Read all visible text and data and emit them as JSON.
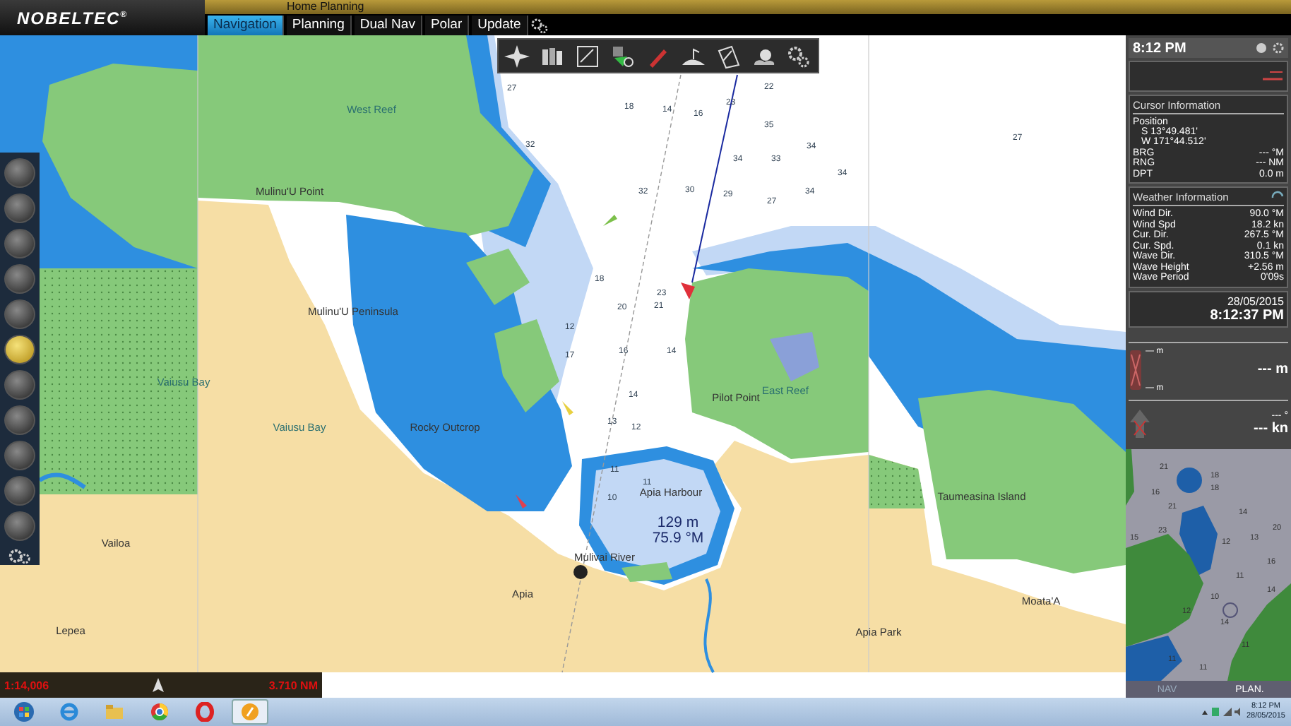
{
  "app": {
    "logo": "NOBELTEC$^{®}$",
    "title": "Home Planning"
  },
  "tabs": [
    {
      "label": "Navigation",
      "selected": true
    },
    {
      "label": "Planning",
      "selected": false
    },
    {
      "label": "Dual Nav",
      "selected": false
    },
    {
      "label": "Polar",
      "selected": false
    },
    {
      "label": "Update",
      "selected": false
    }
  ],
  "left_tools": [
    {
      "selected": false
    },
    {
      "selected": false
    },
    {
      "selected": false
    },
    {
      "selected": false
    },
    {
      "selected": false
    },
    {
      "selected": true
    },
    {
      "selected": false
    },
    {
      "selected": false
    },
    {
      "selected": false
    },
    {
      "selected": false
    },
    {
      "selected": false
    }
  ],
  "chart": {
    "labels": [
      {
        "text": "West Reef",
        "kind": "water"
      },
      {
        "text": "Mulinu'U Point",
        "kind": "place"
      },
      {
        "text": "Mulinu'U Peninsula",
        "kind": "place"
      },
      {
        "text": "Vaiusu Bay",
        "kind": "water"
      },
      {
        "text": "Vaiusu Bay",
        "kind": "water"
      },
      {
        "text": "Rocky Outcrop",
        "kind": "place"
      },
      {
        "text": "Pilot Point",
        "kind": "place"
      },
      {
        "text": "East Reef",
        "kind": "water"
      },
      {
        "text": "Apia Harbour",
        "kind": "place"
      },
      {
        "text": "129 m",
        "kind": "readout"
      },
      {
        "text": "75.9 °M",
        "kind": "readout"
      },
      {
        "text": "Mulivai River",
        "kind": "place"
      },
      {
        "text": "Apia",
        "kind": "place"
      },
      {
        "text": "Vailoa",
        "kind": "place"
      },
      {
        "text": "Lepea",
        "kind": "place"
      },
      {
        "text": "Taumeasina Island",
        "kind": "place"
      },
      {
        "text": "Apia Park",
        "kind": "place"
      },
      {
        "text": "Moata'A",
        "kind": "place"
      }
    ],
    "soundings": [
      "27",
      "32",
      "18",
      "14",
      "16",
      "23",
      "22",
      "35",
      "34",
      "33",
      "34",
      "32",
      "30",
      "29",
      "27",
      "34",
      "34",
      "27",
      "18",
      "20",
      "21",
      "23",
      "17",
      "16",
      "14",
      "14",
      "12",
      "11",
      "11",
      "10",
      "12",
      "13"
    ]
  },
  "info_panel": {
    "time": "8:12 PM",
    "cursor": {
      "title": "Cursor Information",
      "position_label": "Position",
      "lat": "S 13°49.481'",
      "lon": "W 171°44.512'",
      "rows": [
        {
          "label": "BRG",
          "value": "--- °M"
        },
        {
          "label": "RNG",
          "value": "--- NM"
        },
        {
          "label": "DPT",
          "value": "0.0 m"
        }
      ]
    },
    "weather": {
      "title": "Weather Information",
      "rows": [
        {
          "label": "Wind Dir.",
          "value": "90.0 °M"
        },
        {
          "label": "Wind Spd",
          "value": "18.2 kn"
        },
        {
          "label": "Cur. Dir.",
          "value": "267.5 °M"
        },
        {
          "label": "Cur. Spd.",
          "value": "0.1 kn"
        },
        {
          "label": "Wave Dir.",
          "value": "310.5 °M"
        },
        {
          "label": "Wave Height",
          "value": "+2.56 m"
        },
        {
          "label": "Wave Period",
          "value": "0'09s"
        }
      ]
    },
    "date": "28/05/2015",
    "clock": "8:12:37 PM",
    "depth_gauge": {
      "upper": "— m",
      "lower": "— m",
      "value": "--- m"
    },
    "course": {
      "heading": "--- °",
      "speed": "--- kn"
    }
  },
  "inset": {
    "soundings": [
      "21",
      "18",
      "16",
      "18",
      "14",
      "23",
      "21",
      "15",
      "12",
      "13",
      "20",
      "16",
      "11",
      "10",
      "14",
      "12",
      "14",
      "11",
      "11",
      "11"
    ],
    "tabs": [
      {
        "label": "NAV",
        "selected": false
      },
      {
        "label": "PLAN.",
        "selected": true
      }
    ]
  },
  "scale_bar": {
    "scale": "1:14,006",
    "distance": "3.710 NM"
  },
  "taskbar": {
    "apps": [
      {
        "kind": "ie",
        "active": false
      },
      {
        "kind": "folder",
        "active": false
      },
      {
        "kind": "chrome",
        "active": false
      },
      {
        "kind": "opera",
        "active": false
      },
      {
        "kind": "app",
        "active": true
      }
    ],
    "time": "8:12 PM",
    "date": "28/05/2015"
  }
}
